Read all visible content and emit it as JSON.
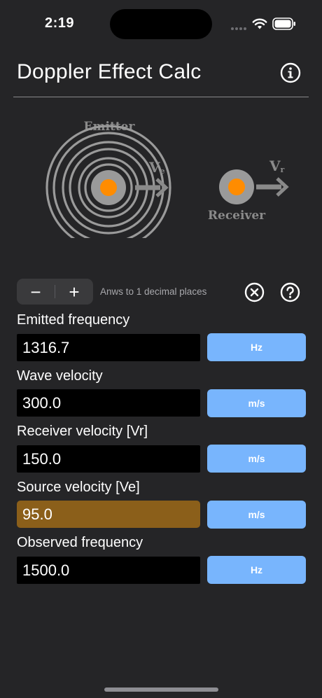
{
  "status_bar": {
    "time": "2:19"
  },
  "header": {
    "title": "Doppler Effect Calc"
  },
  "diagram": {
    "emitter_label": "Emitter",
    "receiver_label": "Receiver",
    "emitter_velocity_label": "V",
    "emitter_velocity_sub": "e",
    "receiver_velocity_label": "V",
    "receiver_velocity_sub": "r",
    "accent_color": "#ff8c00",
    "ring_color": "#9a9a9a"
  },
  "controls": {
    "decrement_symbol": "−",
    "increment_symbol": "+",
    "precision_text": "Anws to 1 decimal places"
  },
  "fields": [
    {
      "label": "Emitted frequency",
      "value": "1316.7",
      "unit": "Hz"
    },
    {
      "label": "Wave velocity",
      "value": "300.0",
      "unit": "m/s"
    },
    {
      "label": "Receiver velocity [Vr]",
      "value": "150.0",
      "unit": "m/s"
    },
    {
      "label": "Source velocity [Ve]",
      "value": "95.0",
      "unit": "m/s"
    },
    {
      "label": "Observed frequency",
      "value": "1500.0",
      "unit": "Hz"
    }
  ],
  "colors": {
    "background": "#252527",
    "unit_button": "#78b5fd",
    "active_field": "#8b5f1a"
  }
}
